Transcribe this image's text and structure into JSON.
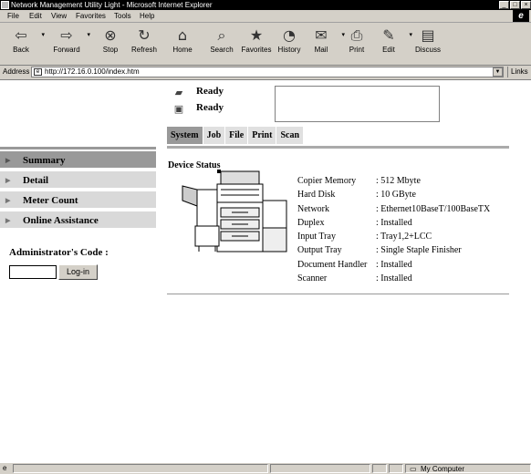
{
  "window": {
    "title": "Network Management Utility Light - Microsoft Internet Explorer",
    "buttons": [
      "_",
      "□",
      "×"
    ]
  },
  "menu": [
    "File",
    "Edit",
    "View",
    "Favorites",
    "Tools",
    "Help"
  ],
  "toolbar": [
    {
      "label": "Back",
      "icon": "back-arrow-icon",
      "glyph": "⇦"
    },
    {
      "label": "Forward",
      "icon": "forward-arrow-icon",
      "glyph": "⇨"
    },
    {
      "label": "Stop",
      "icon": "stop-icon",
      "glyph": "⊗"
    },
    {
      "label": "Refresh",
      "icon": "refresh-icon",
      "glyph": "↻"
    },
    {
      "label": "Home",
      "icon": "home-icon",
      "glyph": "⌂"
    },
    {
      "label": "Search",
      "icon": "search-icon",
      "glyph": "⌕"
    },
    {
      "label": "Favorites",
      "icon": "favorites-icon",
      "glyph": "★"
    },
    {
      "label": "History",
      "icon": "history-icon",
      "glyph": "◔"
    },
    {
      "label": "Mail",
      "icon": "mail-icon",
      "glyph": "✉"
    },
    {
      "label": "Print",
      "icon": "print-icon",
      "glyph": "⎙"
    },
    {
      "label": "Edit",
      "icon": "edit-icon",
      "glyph": "✎"
    },
    {
      "label": "Discuss",
      "icon": "discuss-icon",
      "glyph": "▤"
    }
  ],
  "address": {
    "label": "Address",
    "url": "http://172.16.0.100/index.htm",
    "links": "Links"
  },
  "status": [
    {
      "icon": "scanner-icon",
      "text": "Ready"
    },
    {
      "icon": "printer-icon",
      "text": "Ready"
    }
  ],
  "tabs": [
    "System",
    "Job",
    "File",
    "Print",
    "Scan"
  ],
  "nav": [
    "Summary",
    "Detail",
    "Meter Count",
    "Online Assistance"
  ],
  "admin": {
    "label": "Administrator's Code :",
    "login": "Log-in"
  },
  "device": {
    "title": "Device Status",
    "specs": [
      {
        "k": "Copier Memory",
        "v": ": 512 Mbyte"
      },
      {
        "k": "Hard Disk",
        "v": ": 10 GByte"
      },
      {
        "k": "Network",
        "v": ": Ethernet10BaseT/100BaseTX"
      },
      {
        "k": "Duplex",
        "v": ": Installed"
      },
      {
        "k": "Input Tray",
        "v": ": Tray1,2+LCC"
      },
      {
        "k": "Output Tray",
        "v": ": Single Staple Finisher"
      },
      {
        "k": "Document Handler",
        "v": ": Installed"
      },
      {
        "k": "Scanner",
        "v": ": Installed"
      }
    ]
  },
  "statusbar": {
    "zone": "My Computer"
  }
}
